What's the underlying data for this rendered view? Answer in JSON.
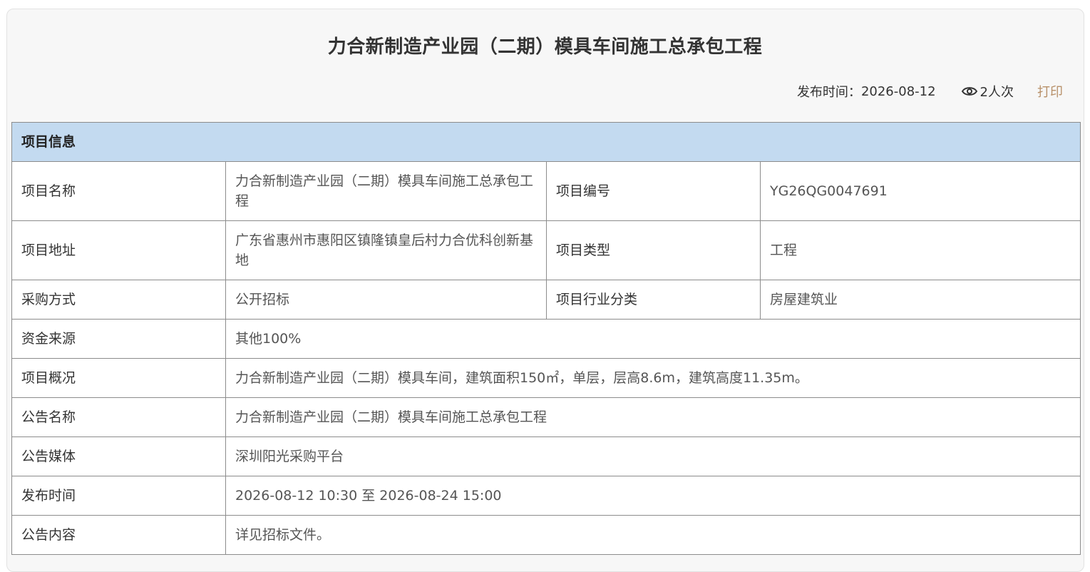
{
  "header": {
    "title": "力合新制造产业园（二期）模具车间施工总承包工程",
    "publish_label": "发布时间：",
    "publish_date": "2026-08-12",
    "views": "2人次",
    "print_label": "打印"
  },
  "section": {
    "title": "项目信息"
  },
  "rows": {
    "project_name": {
      "label": "项目名称",
      "value": "力合新制造产业园（二期）模具车间施工总承包工程"
    },
    "project_code": {
      "label": "项目编号",
      "value": "YG26QG0047691"
    },
    "project_address": {
      "label": "项目地址",
      "value": "广东省惠州市惠阳区镇隆镇皇后村力合优科创新基地"
    },
    "project_type": {
      "label": "项目类型",
      "value": "工程"
    },
    "procurement_method": {
      "label": "采购方式",
      "value": "公开招标"
    },
    "industry": {
      "label": "项目行业分类",
      "value": "房屋建筑业"
    },
    "funding": {
      "label": "资金来源",
      "value": "其他100%"
    },
    "overview": {
      "label": "项目概况",
      "value": "力合新制造产业园（二期）模具车间，建筑面积150㎡，单层，层高8.6m，建筑高度11.35m。"
    },
    "notice_name": {
      "label": "公告名称",
      "value": "力合新制造产业园（二期）模具车间施工总承包工程"
    },
    "notice_media": {
      "label": "公告媒体",
      "value": "深圳阳光采购平台"
    },
    "publish_time": {
      "label": "发布时间",
      "value": "2026-08-12 10:30 至 2026-08-24 15:00"
    },
    "notice_content": {
      "label": "公告内容",
      "value": "详见招标文件。"
    }
  },
  "colors": {
    "section_bg": "#c3daf0",
    "print_link": "#b8916a",
    "card_bg": "#f7f7f7",
    "border": "#8c8c8c"
  },
  "icons": {
    "views": "eye-icon"
  }
}
